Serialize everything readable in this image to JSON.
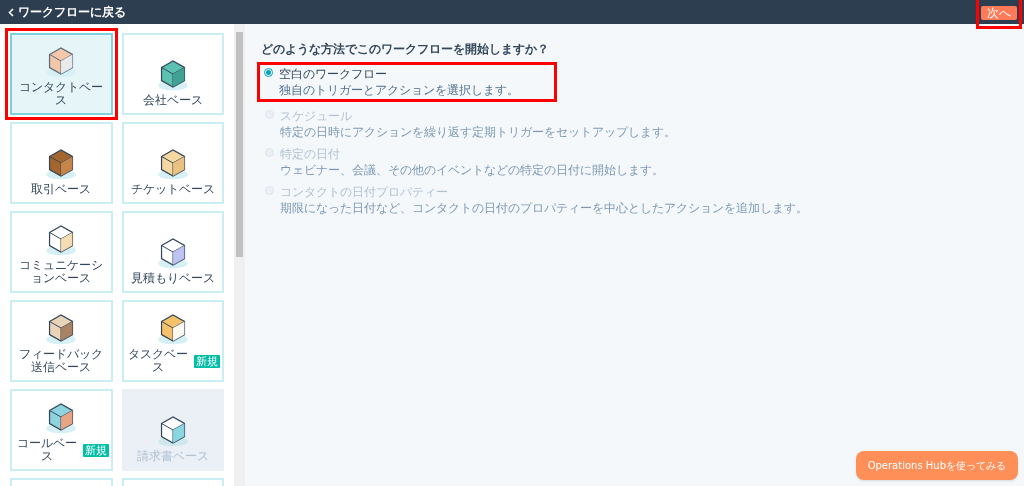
{
  "top_bar": {
    "back_link": "ワークフローに戻る",
    "next_button": {
      "label": "次へ",
      "highlighted": true
    }
  },
  "cards": [
    {
      "label": "コンタクトベース",
      "selected": true,
      "disabled": false,
      "highlighted": true
    },
    {
      "label": "会社ベース",
      "selected": false,
      "disabled": false,
      "highlighted": false
    },
    {
      "label": "取引ベース",
      "selected": false,
      "disabled": false,
      "highlighted": false
    },
    {
      "label": "チケットベース",
      "selected": false,
      "disabled": false,
      "highlighted": false
    },
    {
      "label": "コミュニケーションベース",
      "selected": false,
      "disabled": false,
      "highlighted": false
    },
    {
      "label": "見積もりベース",
      "selected": false,
      "disabled": false,
      "highlighted": false
    },
    {
      "label": "フィードバック送信ベース",
      "selected": false,
      "disabled": false,
      "highlighted": false
    },
    {
      "label": "タスクベース",
      "badge": "新規",
      "selected": false,
      "disabled": false,
      "highlighted": false
    },
    {
      "label": "コールベース",
      "badge": "新規",
      "selected": false,
      "disabled": false,
      "highlighted": false
    },
    {
      "label": "請求書ベース",
      "selected": false,
      "disabled": true,
      "highlighted": false
    }
  ],
  "question": "どのような方法でこのワークフローを開始しますか？",
  "options": [
    {
      "title": "空白のワークフロー",
      "description": "独自のトリガーとアクションを選択します。",
      "selected": true,
      "disabled": false,
      "highlighted": true
    },
    {
      "title": "スケジュール",
      "description": "特定の日時にアクションを繰り返す定期トリガーをセットアップします。",
      "selected": false,
      "disabled": true,
      "highlighted": false
    },
    {
      "title": "特定の日付",
      "description": "ウェビナー、会議、その他のイベントなどの特定の日付に開始します。",
      "selected": false,
      "disabled": true,
      "highlighted": false
    },
    {
      "title": "コンタクトの日付プロパティー",
      "description": "期限になった日付など、コンタクトの日付のプロパティーを中心としたアクションを追加します。",
      "selected": false,
      "disabled": true,
      "highlighted": false
    }
  ],
  "help_button": "Operations Hubを使ってみる"
}
